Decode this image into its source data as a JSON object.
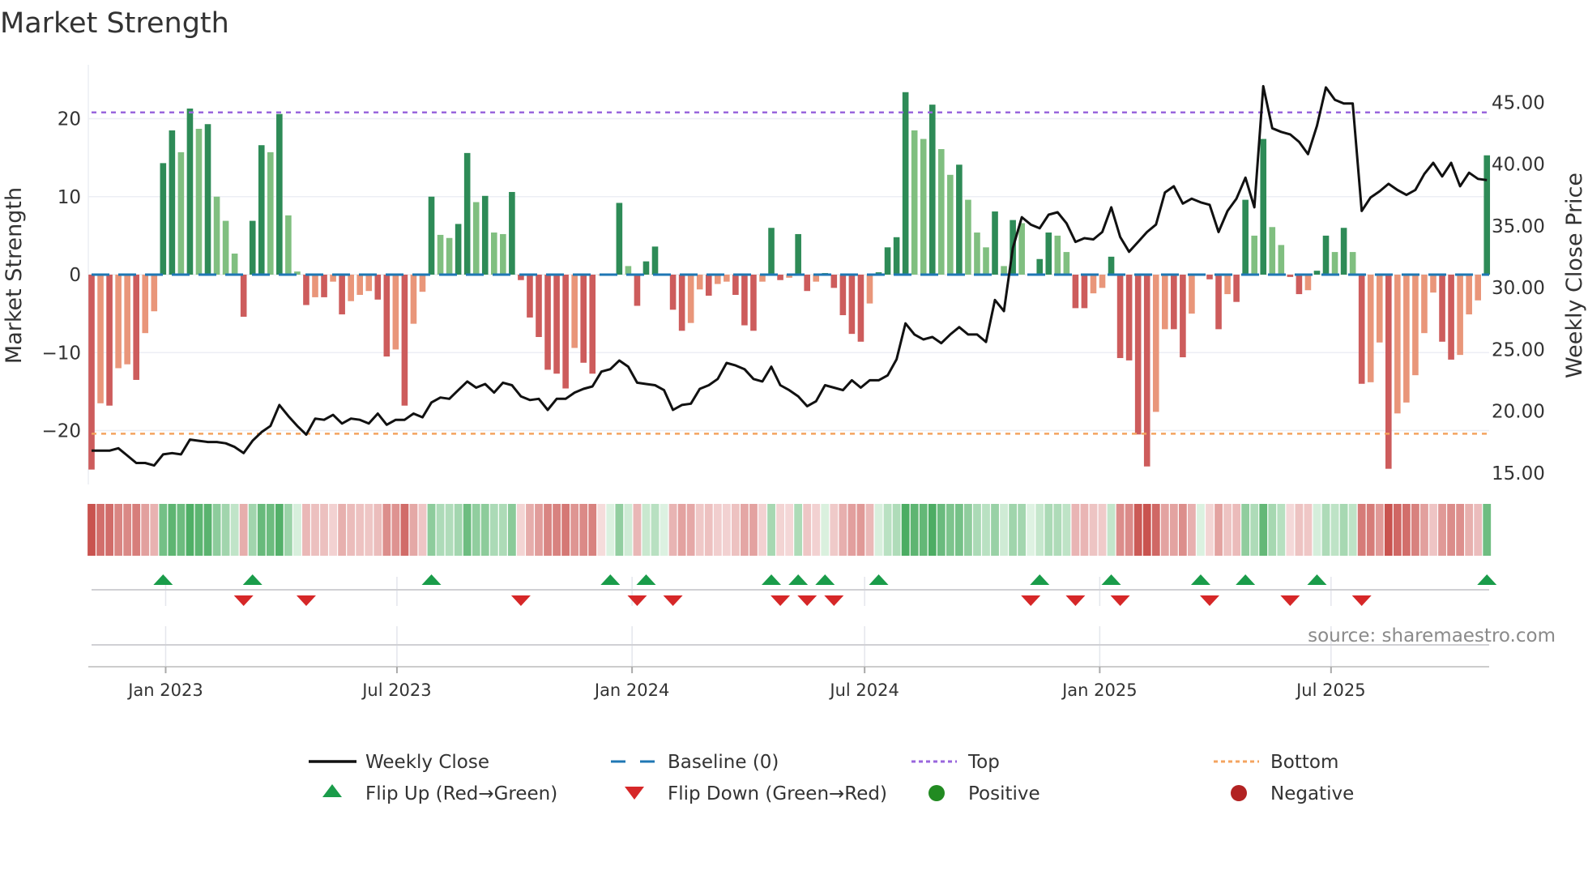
{
  "chart_data": {
    "type": "bar",
    "title": "Market Strength",
    "ylabel": "Market Strength",
    "y2label": "Weekly Close Price",
    "ylim": [
      -27,
      27
    ],
    "y2lim": [
      13.2,
      48.6
    ],
    "yticks": [
      20,
      10,
      0,
      -10,
      -20
    ],
    "ytick_labels": [
      "20",
      "10",
      "0",
      "−10",
      "−20"
    ],
    "y2ticks": [
      45,
      40,
      35,
      30,
      25,
      20,
      15
    ],
    "y2tick_labels": [
      "45.00",
      "40.00",
      "35.00",
      "30.00",
      "25.00",
      "20.00",
      "15.00"
    ],
    "start_date": "2022-11-04",
    "frequency": "weekly",
    "xticks": [
      {
        "date": "2023-01-01",
        "label": "Jan 2023"
      },
      {
        "date": "2023-07-01",
        "label": "Jul 2023"
      },
      {
        "date": "2024-01-01",
        "label": "Jan 2024"
      },
      {
        "date": "2024-07-01",
        "label": "Jul 2024"
      },
      {
        "date": "2025-01-01",
        "label": "Jan 2025"
      },
      {
        "date": "2025-07-01",
        "label": "Jul 2025"
      }
    ],
    "top_level": 20.8,
    "bottom_level": -20.4,
    "strength": [
      -25,
      -16.5,
      -16.8,
      -12,
      -11.5,
      -13.5,
      -7.5,
      -4.7,
      14.3,
      18.5,
      15.7,
      21.3,
      18.7,
      19.3,
      10,
      6.9,
      2.7,
      -5.4,
      6.9,
      16.6,
      15.7,
      20.6,
      7.6,
      0.4,
      -3.9,
      -2.9,
      -2.9,
      -0.9,
      -5.1,
      -3.4,
      -2.6,
      -2.1,
      -3.2,
      -10.5,
      -9.6,
      -16.8,
      -6.3,
      -2.2,
      10,
      5.1,
      4.7,
      6.5,
      15.6,
      9.3,
      10.1,
      5.4,
      5.2,
      10.6,
      -0.7,
      -5.5,
      -8,
      -12.2,
      -12.7,
      -14.6,
      -9.4,
      -11.3,
      -12.7,
      -0.1,
      0.1,
      9.2,
      1.1,
      -4,
      1.7,
      3.6,
      0.05,
      -4.5,
      -7.2,
      -6.2,
      -1.9,
      -2.7,
      -1.2,
      -0.9,
      -2.6,
      -6.5,
      -7.2,
      -0.9,
      6,
      -0.7,
      -0.4,
      5.2,
      -2.1,
      -0.9,
      0.2,
      -1.7,
      -5.2,
      -7.6,
      -8.6,
      -3.7,
      0.3,
      3.5,
      4.8,
      23.4,
      18.5,
      17.4,
      21.8,
      16.1,
      12.8,
      14.1,
      9.6,
      5.4,
      3.5,
      8.1,
      1.1,
      7,
      6.6,
      0,
      2,
      5.4,
      5,
      2.9,
      -4.3,
      -4.3,
      -2.4,
      -1.7,
      2.3,
      -10.7,
      -11,
      -20.5,
      -24.6,
      -17.6,
      -7,
      -7,
      -10.6,
      -5,
      0.1,
      -0.6,
      -7,
      -2.5,
      -3.5,
      9.6,
      5,
      17.4,
      6.1,
      3.8,
      -0.3,
      -2.5,
      -2,
      0.5,
      5,
      2.9,
      6,
      2.9,
      -14,
      -13.8,
      -8.7,
      -24.9,
      -17.8,
      -16.4,
      -12.9,
      -7.5,
      -2.3,
      -8.6,
      -10.9,
      -10.3,
      -5.1,
      -3.3,
      15.3
    ],
    "weekly_close": [
      16.8,
      16.8,
      16.8,
      17.0,
      16.4,
      15.8,
      15.8,
      15.6,
      16.5,
      16.6,
      16.5,
      17.7,
      17.6,
      17.5,
      17.5,
      17.4,
      17.1,
      16.6,
      17.6,
      18.3,
      18.8,
      20.5,
      19.6,
      18.8,
      18.1,
      19.4,
      19.3,
      19.7,
      19.0,
      19.4,
      19.3,
      19.0,
      19.8,
      18.9,
      19.3,
      19.3,
      19.8,
      19.5,
      20.7,
      21.1,
      21.0,
      21.7,
      22.4,
      21.9,
      22.2,
      21.5,
      22.3,
      22.1,
      21.2,
      20.9,
      21.0,
      20.1,
      21.0,
      21.0,
      21.5,
      21.8,
      22.0,
      23.2,
      23.4,
      24.1,
      23.6,
      22.3,
      22.2,
      22.1,
      21.7,
      20.1,
      20.5,
      20.6,
      21.8,
      22.1,
      22.6,
      23.9,
      23.7,
      23.4,
      22.6,
      22.4,
      23.6,
      22.1,
      21.7,
      21.2,
      20.4,
      20.8,
      22.1,
      21.9,
      21.7,
      22.5,
      21.9,
      22.5,
      22.5,
      22.9,
      24.2,
      27.1,
      26.2,
      25.8,
      26.0,
      25.5,
      26.2,
      26.8,
      26.2,
      26.2,
      25.6,
      29.0,
      28.1,
      33.2,
      35.7,
      35.1,
      34.8,
      35.9,
      36.1,
      35.2,
      33.7,
      34.0,
      33.9,
      34.5,
      36.5,
      34.1,
      32.9,
      33.7,
      34.5,
      35.1,
      37.7,
      38.2,
      36.8,
      37.2,
      36.9,
      36.7,
      34.5,
      36.2,
      37.2,
      38.9,
      36.5,
      46.3,
      42.9,
      42.6,
      42.4,
      41.8,
      40.8,
      43.1,
      46.2,
      45.2,
      44.9,
      44.9,
      36.2,
      37.3,
      37.8,
      38.4,
      37.9,
      37.5,
      37.9,
      39.2,
      40.1,
      39.0,
      40.1,
      38.2,
      39.3,
      38.8,
      38.7
    ],
    "flip_up_weeks": [
      8,
      18,
      38,
      58,
      62,
      76,
      79,
      82,
      88,
      106,
      114,
      124,
      129,
      137,
      156
    ],
    "flip_down_weeks": [
      17,
      24,
      48,
      61,
      65,
      77,
      80,
      83,
      105,
      110,
      115,
      125,
      134,
      142
    ],
    "colors": {
      "pos_rising": "#2e8b57",
      "pos_falling": "#80bf80",
      "neg_falling": "#cd5c5c",
      "neg_rising": "#e9967a",
      "close_line": "#111111",
      "baseline": "#1f77b4",
      "top": "#9966dd",
      "bottom": "#f4a460",
      "flip_up": "#1a9c4a",
      "flip_down": "#d62728",
      "positive": "#228b22",
      "negative": "#b22222"
    },
    "legend": [
      {
        "label": "Weekly Close",
        "kind": "line"
      },
      {
        "label": "Baseline (0)",
        "kind": "dash"
      },
      {
        "label": "Top",
        "kind": "dot-top"
      },
      {
        "label": "Bottom",
        "kind": "dot-bottom"
      },
      {
        "label": "Flip Up (Red→Green)",
        "kind": "tri-up"
      },
      {
        "label": "Flip Down (Green→Red)",
        "kind": "tri-down"
      },
      {
        "label": "Positive",
        "kind": "circle-pos"
      },
      {
        "label": "Negative",
        "kind": "circle-neg"
      }
    ],
    "legend_placement": "bottom",
    "source": "source: sharemaestro.com"
  }
}
